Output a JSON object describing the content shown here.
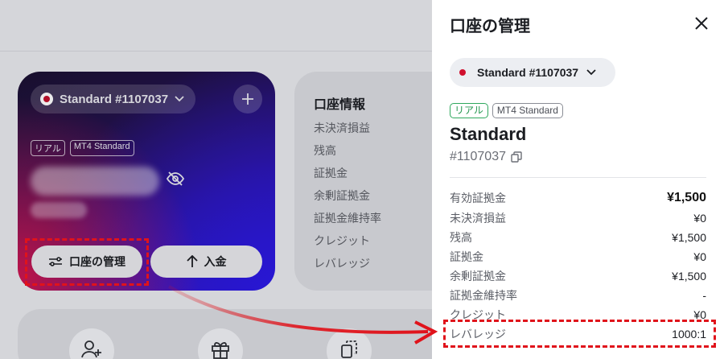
{
  "background": {
    "account_card": {
      "account_label": "Standard #1107037",
      "tags": [
        "リアル",
        "MT4 Standard"
      ],
      "manage_button": "口座の管理",
      "deposit_button": "入金"
    },
    "info_card": {
      "title": "口座情報",
      "items": [
        "未決済損益",
        "残高",
        "証拠金",
        "余剰証拠金",
        "証拠金維持率",
        "クレジット",
        "レバレッジ"
      ]
    }
  },
  "panel": {
    "title": "口座の管理",
    "selector_label": "Standard #1107037",
    "tag_real": "リアル",
    "tag_type": "MT4 Standard",
    "account_type": "Standard",
    "account_number": "#1107037",
    "rows": [
      {
        "label": "有効証拠金",
        "value": "¥1,500"
      },
      {
        "label": "未決済損益",
        "value": "¥0"
      },
      {
        "label": "残高",
        "value": "¥1,500"
      },
      {
        "label": "証拠金",
        "value": "¥0"
      },
      {
        "label": "余剰証拠金",
        "value": "¥1,500"
      },
      {
        "label": "証拠金維持率",
        "value": "-"
      },
      {
        "label": "クレジット",
        "value": "¥0"
      },
      {
        "label": "レバレッジ",
        "value": "1000:1"
      }
    ]
  },
  "colors": {
    "highlight": "#e0131b",
    "real_tag": "#2fa85d",
    "account_dot": "#d0102e"
  },
  "icons": [
    "plus-icon",
    "eye-off-icon",
    "sliders-icon",
    "arrow-up-icon",
    "close-icon",
    "chevron-down-icon",
    "copy-icon",
    "user-add-icon",
    "gift-icon",
    "transfer-icon"
  ]
}
